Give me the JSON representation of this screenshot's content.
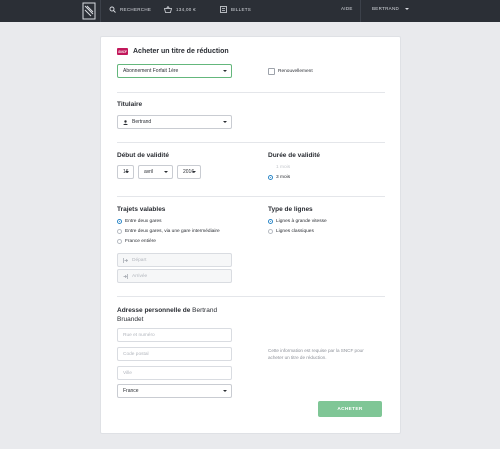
{
  "topbar": {
    "nav": [
      {
        "icon": "search-icon",
        "label": "RECHERCHE"
      },
      {
        "icon": "basket-icon",
        "label": "134,00 €"
      },
      {
        "icon": "ticket-icon",
        "label": "BILLETS"
      }
    ],
    "help": "AIDE",
    "user": "BERTRAND"
  },
  "form": {
    "logo_text": "SNCF",
    "title": "Acheter un titre de réduction",
    "card_type": "Abonnement Forfait 1ère",
    "renewal_label": "Renouvellement",
    "holder": {
      "heading": "Titulaire",
      "value": "Bertrand"
    },
    "validity": {
      "heading": "Début de validité",
      "day": "16",
      "month": "avril",
      "year": "2016"
    },
    "duration": {
      "heading": "Durée de validité",
      "options": [
        "1 mois",
        "3 mois"
      ],
      "selected": "3 mois"
    },
    "routes": {
      "heading": "Trajets valables",
      "options": [
        "Entre deux gares",
        "Entre deux gares, via une gare intermédiaire",
        "France entière"
      ],
      "selected": "Entre deux gares",
      "departure_placeholder": "Départ",
      "arrival_placeholder": "Arrivée"
    },
    "line_type": {
      "heading": "Type de lignes",
      "options": [
        "Lignes à grande vitesse",
        "Lignes classiques"
      ],
      "selected": "Lignes à grande vitesse"
    },
    "address": {
      "heading_prefix": "Adresse personnelle de ",
      "heading_name": "Bertrand Bruandet",
      "street_placeholder": "Rue et numéro",
      "zip_placeholder": "Code postal",
      "city_placeholder": "Ville",
      "country": "France",
      "info_text": "Cette information est requise par la SNCF pour acheter un titre de réduction."
    },
    "submit_label": "ACHETER"
  },
  "colors": {
    "topbar": "#2b2f36",
    "accent_blue": "#2c87c7",
    "button_green": "#7fc696",
    "sncf": "#c2185b"
  }
}
